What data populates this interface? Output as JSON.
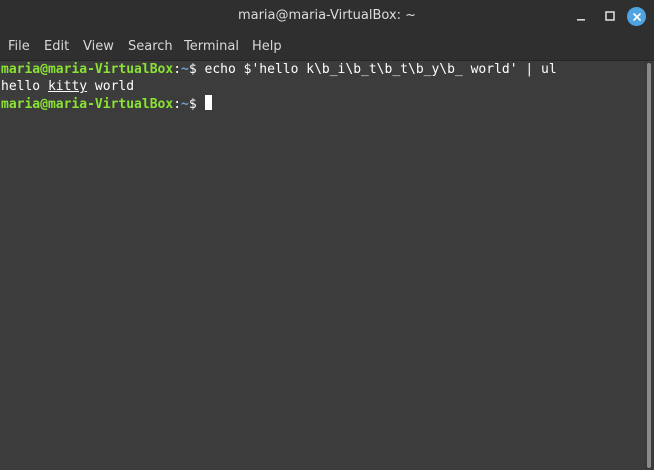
{
  "window": {
    "title": "maria@maria-VirtualBox: ~"
  },
  "menu": {
    "items": [
      "File",
      "Edit",
      "View",
      "Search",
      "Terminal",
      "Help"
    ]
  },
  "terminal": {
    "prompt_user": "maria@maria-VirtualBox",
    "prompt_colon": ":",
    "prompt_path": "~",
    "prompt_symbol": "$ ",
    "command": "echo $'hello k\\b_i\\b_t\\b_t\\b_y\\b_ world' | ul",
    "output_before": "hello ",
    "output_underlined": "kitty",
    "output_after": " world"
  },
  "icons": {
    "minimize": "minimize-icon",
    "maximize": "maximize-icon",
    "close": "close-icon"
  },
  "colors": {
    "prompt_user": "#8ae234",
    "prompt_path": "#729fcf",
    "background": "#3c3c3c",
    "close_button": "#4fa3e0"
  }
}
